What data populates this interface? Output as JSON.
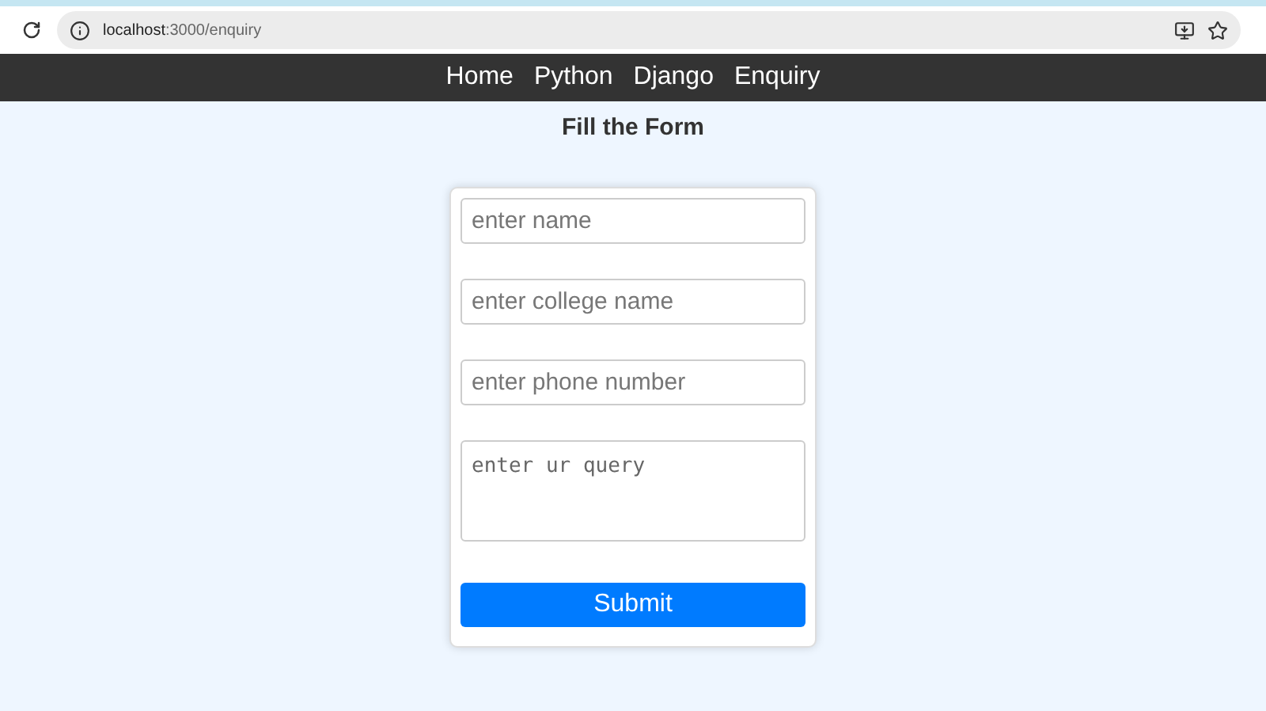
{
  "browser": {
    "url_host": "localhost",
    "url_path": ":3000/enquiry"
  },
  "nav": {
    "items": [
      {
        "label": "Home"
      },
      {
        "label": "Python"
      },
      {
        "label": "Django"
      },
      {
        "label": "Enquiry"
      }
    ]
  },
  "form": {
    "title": "Fill the Form",
    "fields": [
      {
        "kind": "input",
        "placeholder": "enter name"
      },
      {
        "kind": "input",
        "placeholder": "enter college name"
      },
      {
        "kind": "input",
        "placeholder": "enter phone number"
      },
      {
        "kind": "textarea",
        "placeholder": "enter ur query"
      }
    ],
    "submit": "Submit"
  }
}
